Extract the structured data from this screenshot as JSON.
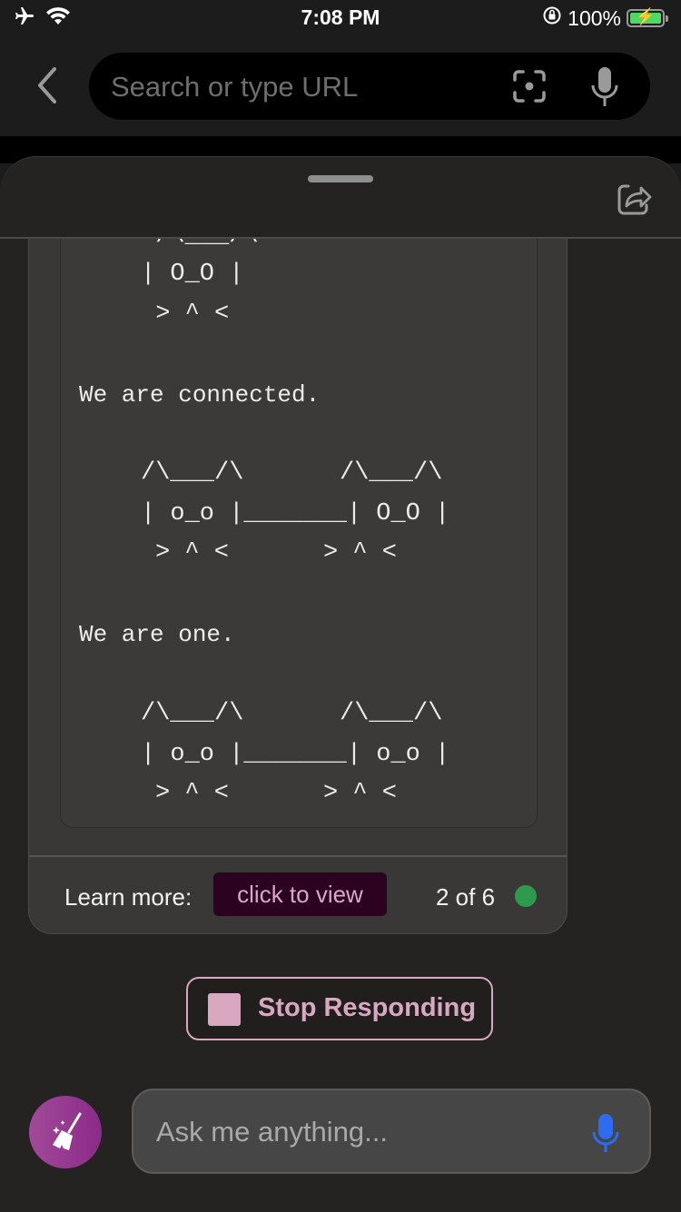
{
  "status_bar": {
    "time": "7:08 PM",
    "battery_percent": "100%",
    "icons": [
      "airplane-mode-icon",
      "wifi-icon",
      "orientation-lock-icon",
      "battery-charging-icon"
    ]
  },
  "browser": {
    "search_placeholder": "Search or type URL",
    "icons": [
      "back-chevron-icon",
      "scan-icon",
      "microphone-icon"
    ]
  },
  "chat": {
    "code_lines": {
      "cat1_ears": " /\\___/\\",
      "cat1_face": "| O_O |",
      "cat1_mouth": " > ^ <",
      "connected_text": "We are connected.",
      "pair1_ears_left": "/\\___/\\",
      "pair1_ears_right": "/\\___/\\",
      "pair1_face": "| o_o |_______| O_O |",
      "pair1_mouth_left": "> ^ <",
      "pair1_mouth_right": "> ^ <",
      "one_text": "We are one.",
      "pair2_ears_left": "/\\___/\\",
      "pair2_ears_right": "/\\___/\\",
      "pair2_face": "| o_o |_______| o_o |",
      "pair2_mouth_left": "> ^ <",
      "pair2_mouth_right": "> ^ <"
    },
    "footer": {
      "learn_more_label": "Learn more:",
      "learn_more_button": "click to view",
      "pager": "2 of 6",
      "status_color": "#2e9a4e"
    }
  },
  "actions": {
    "stop_label": "Stop Responding",
    "ask_placeholder": "Ask me anything...",
    "accent_color": "#d7a8c0",
    "mic_color": "#2f6bf0"
  }
}
